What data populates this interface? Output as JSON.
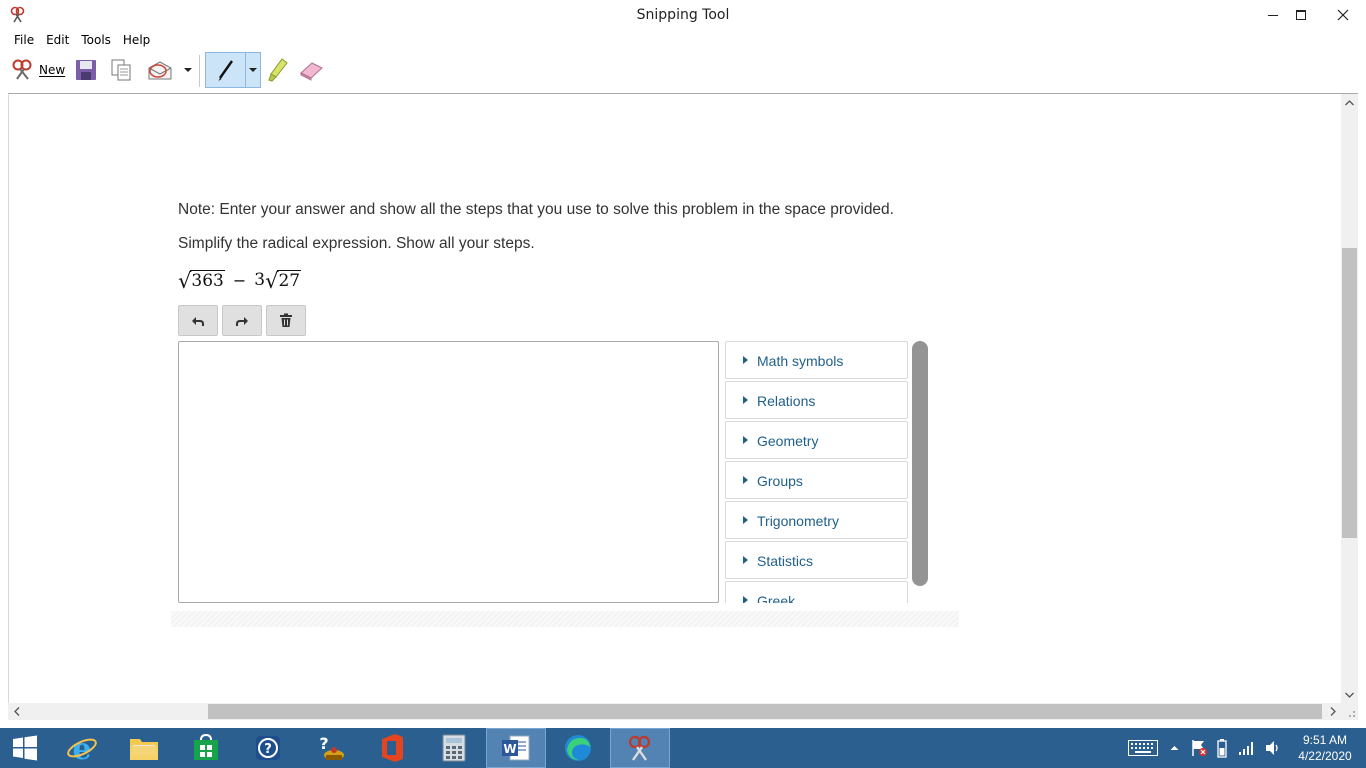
{
  "window": {
    "title": "Snipping Tool"
  },
  "menu": {
    "items": [
      "File",
      "Edit",
      "Tools",
      "Help"
    ]
  },
  "toolbar": {
    "new_label": "New"
  },
  "content": {
    "note": "Note: Enter your answer and show all the steps that you use to solve this problem in the space provided.",
    "question": "Simplify the radical expression. Show all your steps.",
    "expression": {
      "radicand_1": "363",
      "operator": "−",
      "coefficient_2": "3",
      "radicand_2": "27"
    },
    "palette": {
      "items": [
        "Math symbols",
        "Relations",
        "Geometry",
        "Groups",
        "Trigonometry",
        "Statistics",
        "Greek"
      ]
    }
  },
  "taskbar": {
    "time": "9:51 AM",
    "date": "4/22/2020"
  },
  "colors": {
    "accent_link": "#1f5f8b",
    "taskbar": "#2a5f8f",
    "pen_selected": "#cce4f7"
  }
}
